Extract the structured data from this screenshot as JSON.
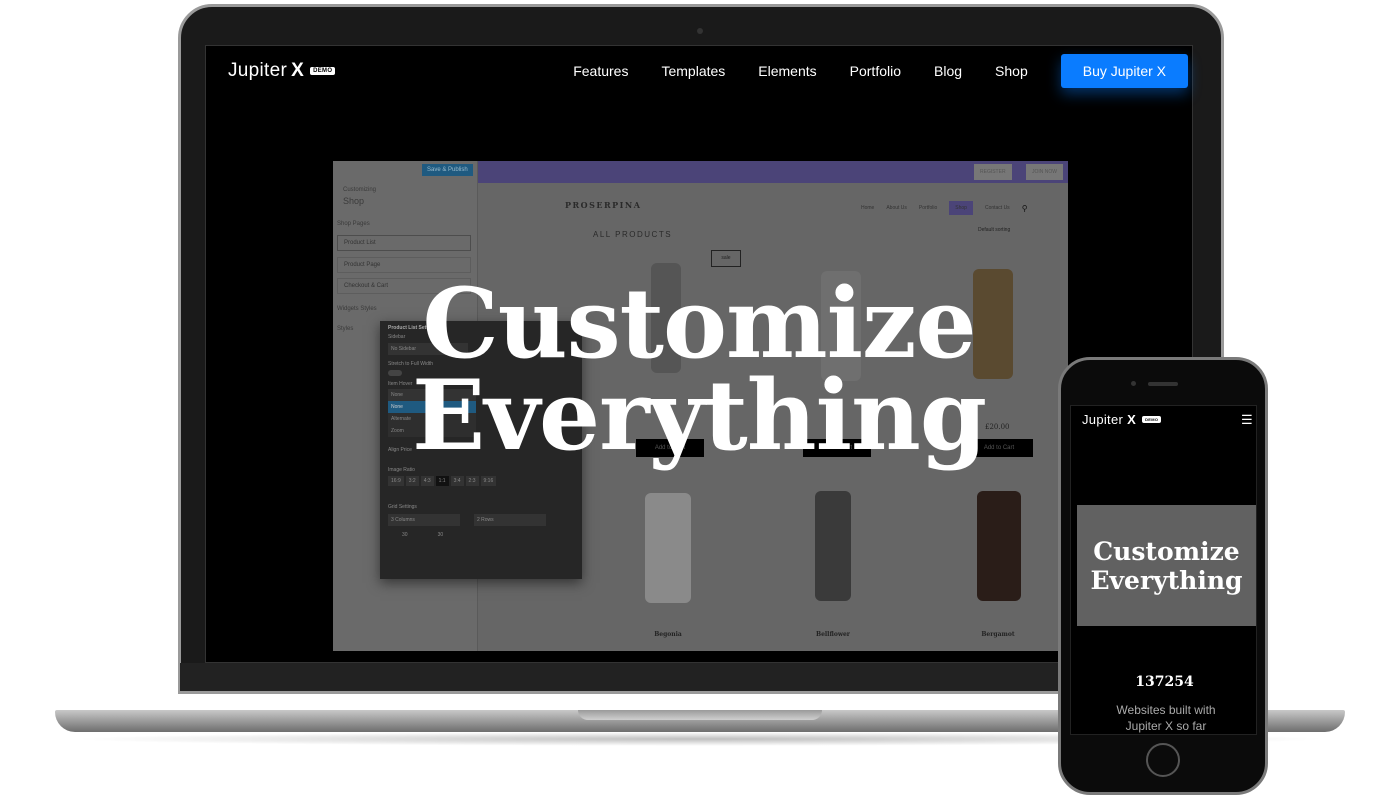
{
  "laptop": {
    "nav": {
      "logo": "Jupiter",
      "logo_x": "X",
      "badge": "DEMO",
      "items": [
        "Features",
        "Templates",
        "Elements",
        "Portfolio",
        "Blog",
        "Shop"
      ],
      "cta": "Buy Jupiter X"
    },
    "headline": [
      "Customize",
      "Everything"
    ],
    "customizer": {
      "save": "Save & Publish",
      "customizing": "Customizing",
      "section": "Shop",
      "group": "Shop Pages",
      "items": [
        "Product List",
        "Product Page",
        "Checkout & Cart"
      ],
      "widgets": "Widgets Styles",
      "styles": "Styles",
      "dialog": {
        "title": "Product List Settings",
        "sidebar_label": "Sidebar",
        "sidebar_value": "No Sidebar",
        "stretch": "Stretch to Full Width",
        "hover_label": "Item Hover",
        "hover_options": [
          "None",
          "None",
          "Alternate",
          "Zoom"
        ],
        "align": "Align Price",
        "ratio_label": "Image Ratio",
        "ratios": [
          "16:9",
          "3:2",
          "4:3",
          "1:1",
          "3:4",
          "2:3",
          "9:16"
        ],
        "grid": "Grid Settings",
        "columns": "3 Columns",
        "rows": "2 Rows",
        "gap_x": "30",
        "gap_y": "30"
      }
    },
    "site": {
      "register": "REGISTER",
      "join": "JOIN NOW",
      "brand": "PROSERPINA",
      "menu": [
        "Home",
        "About Us",
        "Portfolio",
        "Shop",
        "Contact Us"
      ],
      "sorting": "Default sorting",
      "heading": "ALL PRODUCTS",
      "sale": "sale",
      "add_to_cart": "Add to Cart",
      "price_visible": "£20.00",
      "products_row2": [
        "Begonia",
        "Bellflower",
        "Bergamot"
      ]
    }
  },
  "phone": {
    "logo": "Jupiter",
    "logo_x": "X",
    "badge": "DEMO",
    "headline": [
      "Customize",
      "Everything"
    ],
    "count": "137254",
    "caption": "Websites built with Jupiter X so far"
  },
  "colors": {
    "cta": "#0a7cff",
    "topbar": "#4b4478"
  }
}
